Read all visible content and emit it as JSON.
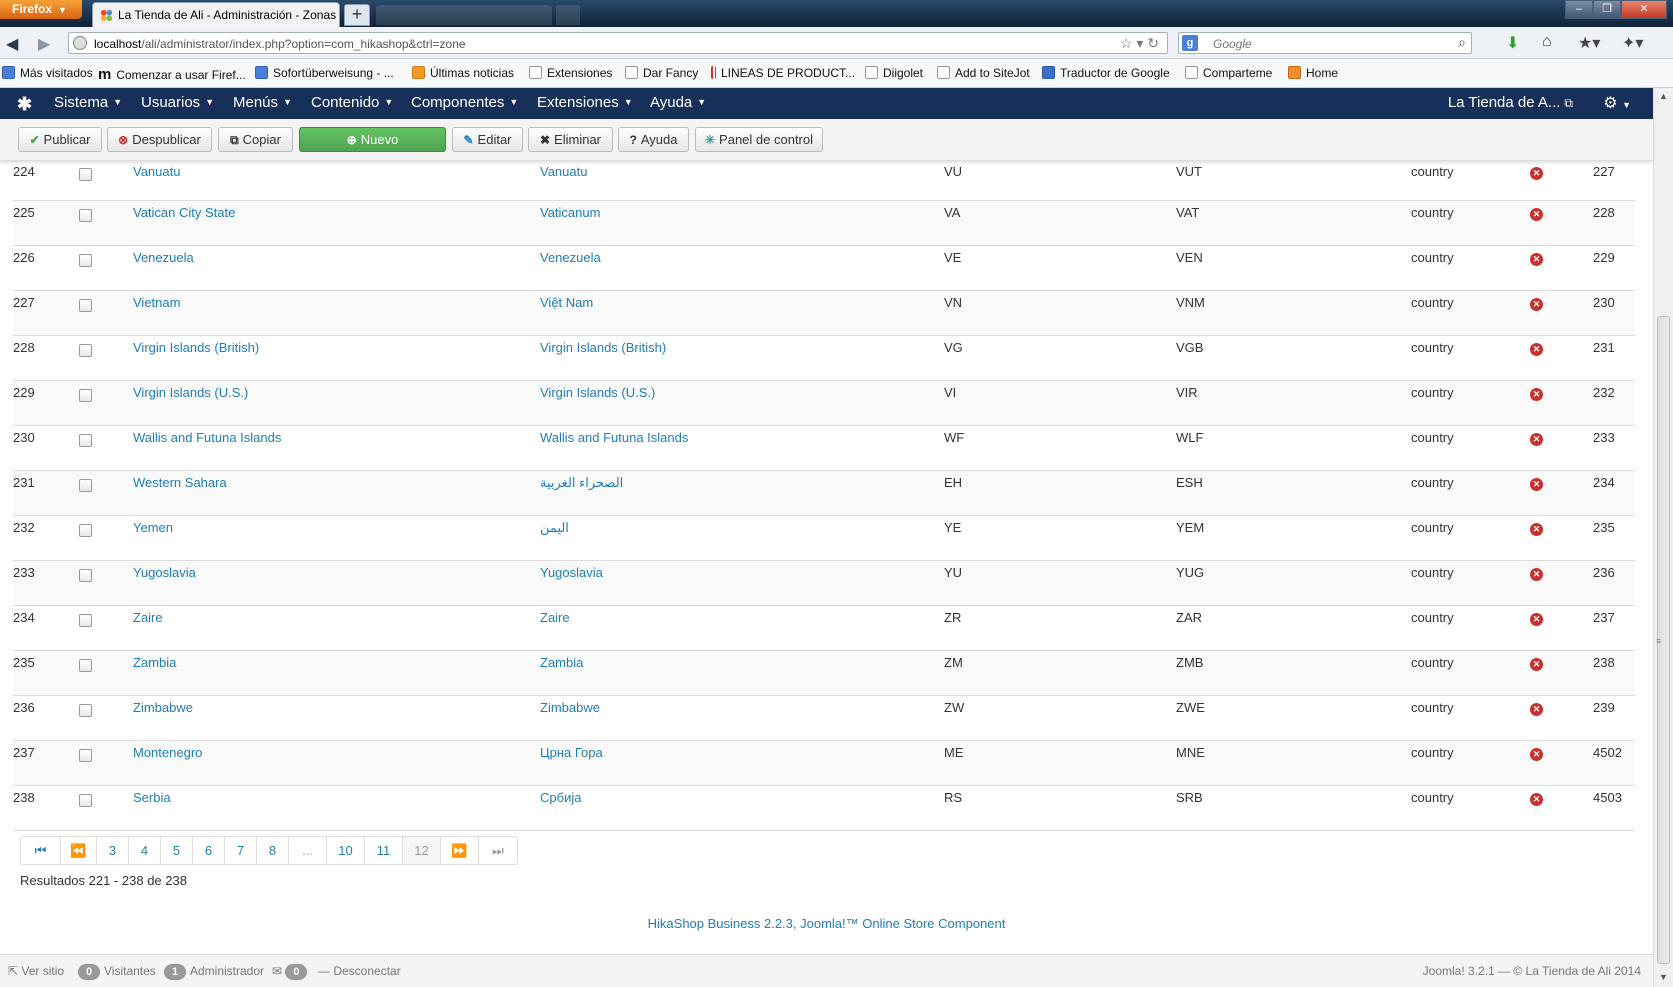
{
  "browser": {
    "app_label": "Firefox",
    "active_tab_title": "La Tienda de Ali - Administración - Zonas",
    "new_tab_glyph": "+",
    "url_host": "localhost",
    "url_path": "/ali/administrator/index.php?option=com_hikashop&ctrl=zone",
    "search_placeholder": "Google",
    "bookmarks": [
      {
        "label": "Más visitados",
        "icon": "bookmark-icon"
      },
      {
        "label": "Comenzar a usar Firef...",
        "icon": "m-icon"
      },
      {
        "label": "Sofortüberweisung - ...",
        "icon": "sofort-icon"
      },
      {
        "label": "Últimas noticias",
        "icon": "rss-icon"
      },
      {
        "label": "Extensiones",
        "icon": "page-icon"
      },
      {
        "label": "Dar Fancy",
        "icon": "page-icon"
      },
      {
        "label": "LINEAS DE PRODUCT...",
        "icon": "lineas-icon"
      },
      {
        "label": "Diigolet",
        "icon": "page-icon"
      },
      {
        "label": "Add to SiteJot",
        "icon": "page-icon"
      },
      {
        "label": "Traductor de Google",
        "icon": "translate-icon"
      },
      {
        "label": "Comparteme",
        "icon": "page-icon"
      },
      {
        "label": "Home",
        "icon": "home-icon"
      }
    ]
  },
  "joomla_nav": {
    "menus": [
      "Sistema",
      "Usuarios",
      "Menús",
      "Contenido",
      "Componentes",
      "Extensiones",
      "Ayuda"
    ],
    "site_label": "La Tienda de A..."
  },
  "toolbar": {
    "publish": "Publicar",
    "unpublish": "Despublicar",
    "copy": "Copiar",
    "new": "Nuevo",
    "edit": "Editar",
    "delete": "Eliminar",
    "help": "Ayuda",
    "control_panel": "Panel de control"
  },
  "zones": [
    {
      "num": "224",
      "name": "Vanuatu",
      "name_english": "Vanuatu",
      "code_2": "VU",
      "code_3": "VUT",
      "type": "country",
      "id": "227"
    },
    {
      "num": "225",
      "name": "Vatican City State",
      "name_english": "Vaticanum",
      "code_2": "VA",
      "code_3": "VAT",
      "type": "country",
      "id": "228"
    },
    {
      "num": "226",
      "name": "Venezuela",
      "name_english": "Venezuela",
      "code_2": "VE",
      "code_3": "VEN",
      "type": "country",
      "id": "229"
    },
    {
      "num": "227",
      "name": "Vietnam",
      "name_english": "Việt Nam",
      "code_2": "VN",
      "code_3": "VNM",
      "type": "country",
      "id": "230"
    },
    {
      "num": "228",
      "name": "Virgin Islands (British)",
      "name_english": "Virgin Islands (British)",
      "code_2": "VG",
      "code_3": "VGB",
      "type": "country",
      "id": "231"
    },
    {
      "num": "229",
      "name": "Virgin Islands (U.S.)",
      "name_english": "Virgin Islands (U.S.)",
      "code_2": "VI",
      "code_3": "VIR",
      "type": "country",
      "id": "232"
    },
    {
      "num": "230",
      "name": "Wallis and Futuna Islands",
      "name_english": "Wallis and Futuna Islands",
      "code_2": "WF",
      "code_3": "WLF",
      "type": "country",
      "id": "233"
    },
    {
      "num": "231",
      "name": "Western Sahara",
      "name_english": "الصحراء الغربية",
      "code_2": "EH",
      "code_3": "ESH",
      "type": "country",
      "id": "234"
    },
    {
      "num": "232",
      "name": "Yemen",
      "name_english": "اليمن",
      "code_2": "YE",
      "code_3": "YEM",
      "type": "country",
      "id": "235"
    },
    {
      "num": "233",
      "name": "Yugoslavia",
      "name_english": "Yugoslavia",
      "code_2": "YU",
      "code_3": "YUG",
      "type": "country",
      "id": "236"
    },
    {
      "num": "234",
      "name": "Zaire",
      "name_english": "Zaire",
      "code_2": "ZR",
      "code_3": "ZAR",
      "type": "country",
      "id": "237"
    },
    {
      "num": "235",
      "name": "Zambia",
      "name_english": "Zambia",
      "code_2": "ZM",
      "code_3": "ZMB",
      "type": "country",
      "id": "238"
    },
    {
      "num": "236",
      "name": "Zimbabwe",
      "name_english": "Zimbabwe",
      "code_2": "ZW",
      "code_3": "ZWE",
      "type": "country",
      "id": "239"
    },
    {
      "num": "237",
      "name": "Montenegro",
      "name_english": "Црна Гора",
      "code_2": "ME",
      "code_3": "MNE",
      "type": "country",
      "id": "4502"
    },
    {
      "num": "238",
      "name": "Serbia",
      "name_english": "Србија",
      "code_2": "RS",
      "code_3": "SRB",
      "type": "country",
      "id": "4503"
    }
  ],
  "pagination": {
    "pages": [
      "3",
      "4",
      "5",
      "6",
      "7",
      "8",
      "...",
      "10",
      "11",
      "12"
    ],
    "current": "12",
    "results": "Resultados 221 - 238 de 238"
  },
  "footer": {
    "component_link": "HikaShop Business 2.2.3, Joomla!™ Online Store Component"
  },
  "statusbar": {
    "view_site": "Ver sitio",
    "visitors_count": "0",
    "visitors_label": "Visitantes",
    "admins_count": "1",
    "admins_label": "Administrador",
    "messages_count": "0",
    "logout": "Desconectar",
    "version": "Joomla! 3.2.1 — © La Tienda de Ali 2014"
  },
  "colors": {
    "joomla_nav_bg": "#17305a",
    "link": "#1f7eb5",
    "new_button": "#5bb75b",
    "unpublished_icon": "#c9302c"
  }
}
